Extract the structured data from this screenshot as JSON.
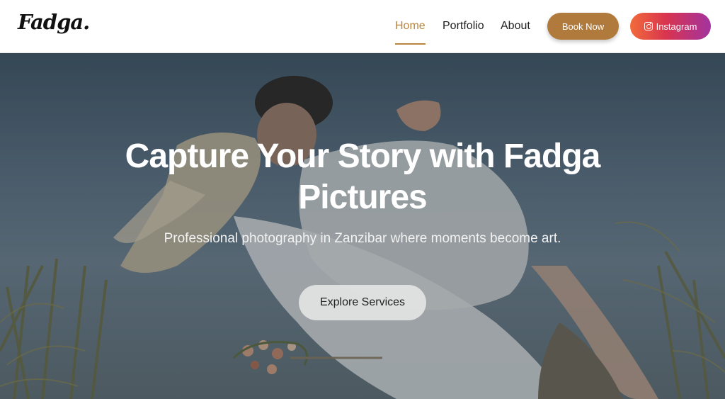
{
  "header": {
    "logo": "Fadga.",
    "nav": [
      {
        "label": "Home",
        "active": true
      },
      {
        "label": "Portfolio",
        "active": false
      },
      {
        "label": "About",
        "active": false
      }
    ],
    "book_button": "Book Now",
    "instagram_button": "Instagram"
  },
  "hero": {
    "title_line1": "Capture Your Story with Fadga",
    "title_line2": "Pictures",
    "subtitle": "Professional photography in Zanzibar where moments become art.",
    "cta": "Explore Services"
  },
  "colors": {
    "accent": "#b8843f",
    "book_button": "#b07a3d",
    "instagram_gradient": [
      "#f26b3a",
      "#d8344f",
      "#a2339f"
    ]
  }
}
